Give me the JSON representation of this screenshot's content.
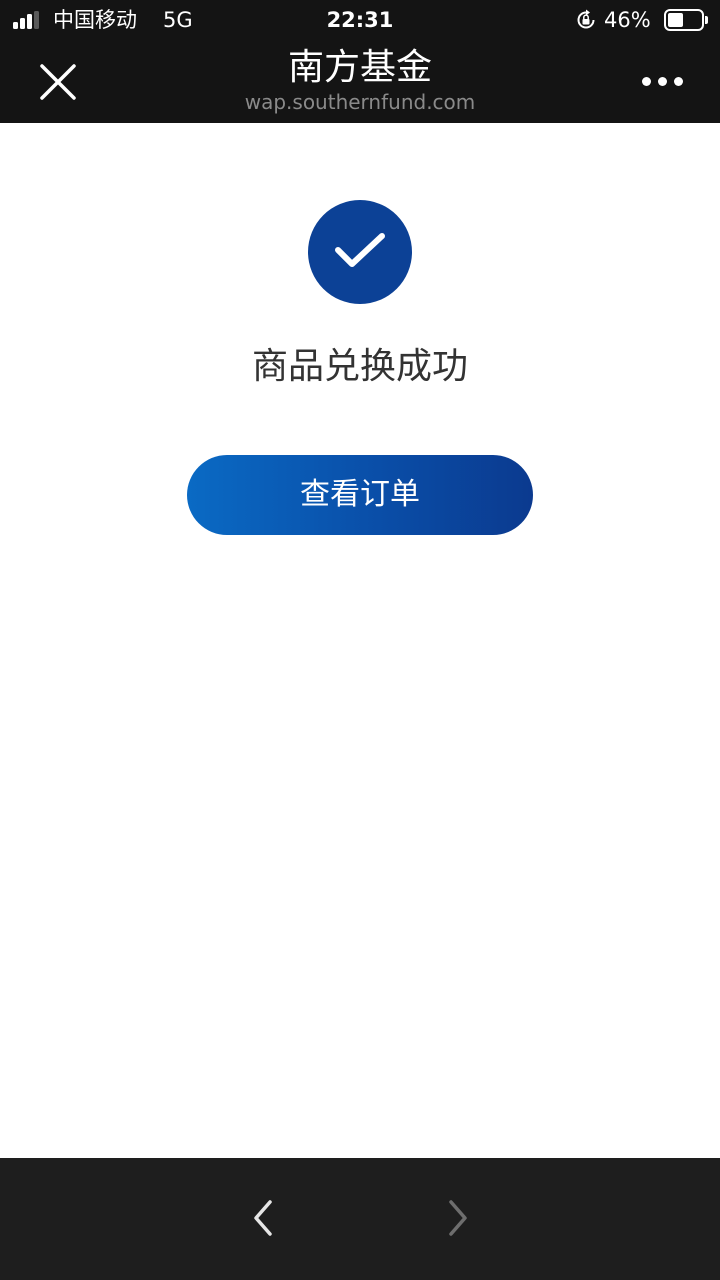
{
  "status_bar": {
    "carrier": "中国移动",
    "network": "5G",
    "time": "22:31",
    "battery_percent": "46%",
    "battery_level": 0.46,
    "icons": [
      "signal-icon",
      "rotation-lock-icon",
      "battery-icon"
    ]
  },
  "title_bar": {
    "title": "南方基金",
    "url": "wap.southernfund.com",
    "icons": [
      "close-icon",
      "more-icon"
    ]
  },
  "main": {
    "success_icon": "check-circle-icon",
    "success_message": "商品兑换成功",
    "view_order_label": "查看订单"
  },
  "bottom_bar": {
    "icons": [
      "back-arrow-icon",
      "forward-arrow-icon"
    ],
    "forward_enabled": false
  },
  "colors": {
    "bar_background": "#141414",
    "bottom_bar_background": "#1e1e1e",
    "accent_blue": "#0c4196",
    "button_gradient_start": "#0a6ac4",
    "button_gradient_end": "#0b3a8f",
    "text_dark": "#333333",
    "url_gray": "#8a8a8a"
  }
}
